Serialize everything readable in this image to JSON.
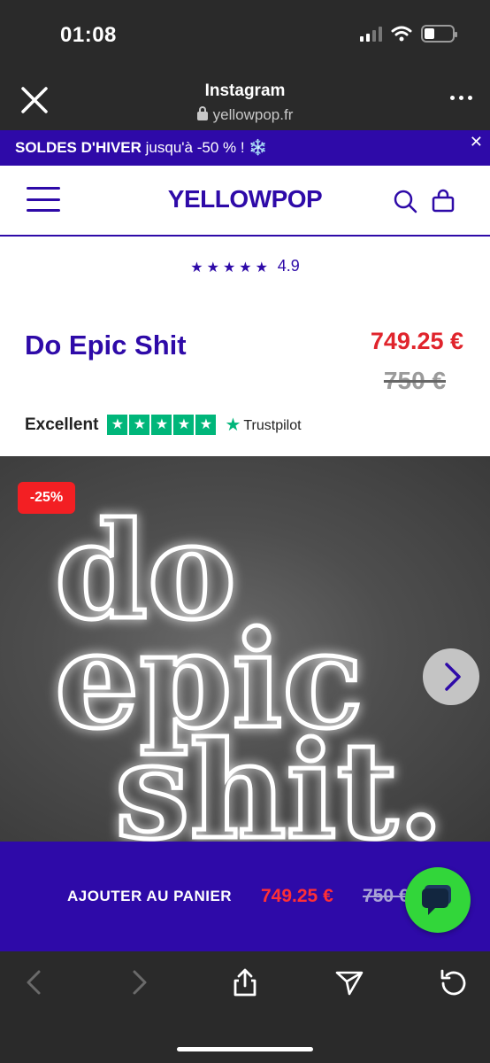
{
  "status_bar": {
    "time": "01:08"
  },
  "browser": {
    "title": "Instagram",
    "url": "yellowpop.fr"
  },
  "promo": {
    "bold_text": "SOLDES D'HIVER",
    "text": "jusqu'à -50 % !",
    "emoji": "❄️",
    "close": "✕"
  },
  "header": {
    "logo": "YELLOWPOP"
  },
  "rating": {
    "stars": "★★★★★",
    "score": "4.9"
  },
  "product": {
    "title": "Do Epic Shit",
    "price_now": "749.25 €",
    "price_old": "750 €",
    "discount_badge": "-25%",
    "neon_lines": [
      "do",
      "epic",
      "shit."
    ]
  },
  "trustpilot": {
    "label": "Excellent",
    "brand": "Trustpilot",
    "star": "★"
  },
  "cart_bar": {
    "label": "AJOUTER AU PANIER",
    "price_now": "749.25 €",
    "price_old": "750 €"
  },
  "colors": {
    "brand": "#2e0aa8",
    "sale": "#e0242c",
    "trustpilot": "#00b67a",
    "chat": "#32d63a"
  }
}
